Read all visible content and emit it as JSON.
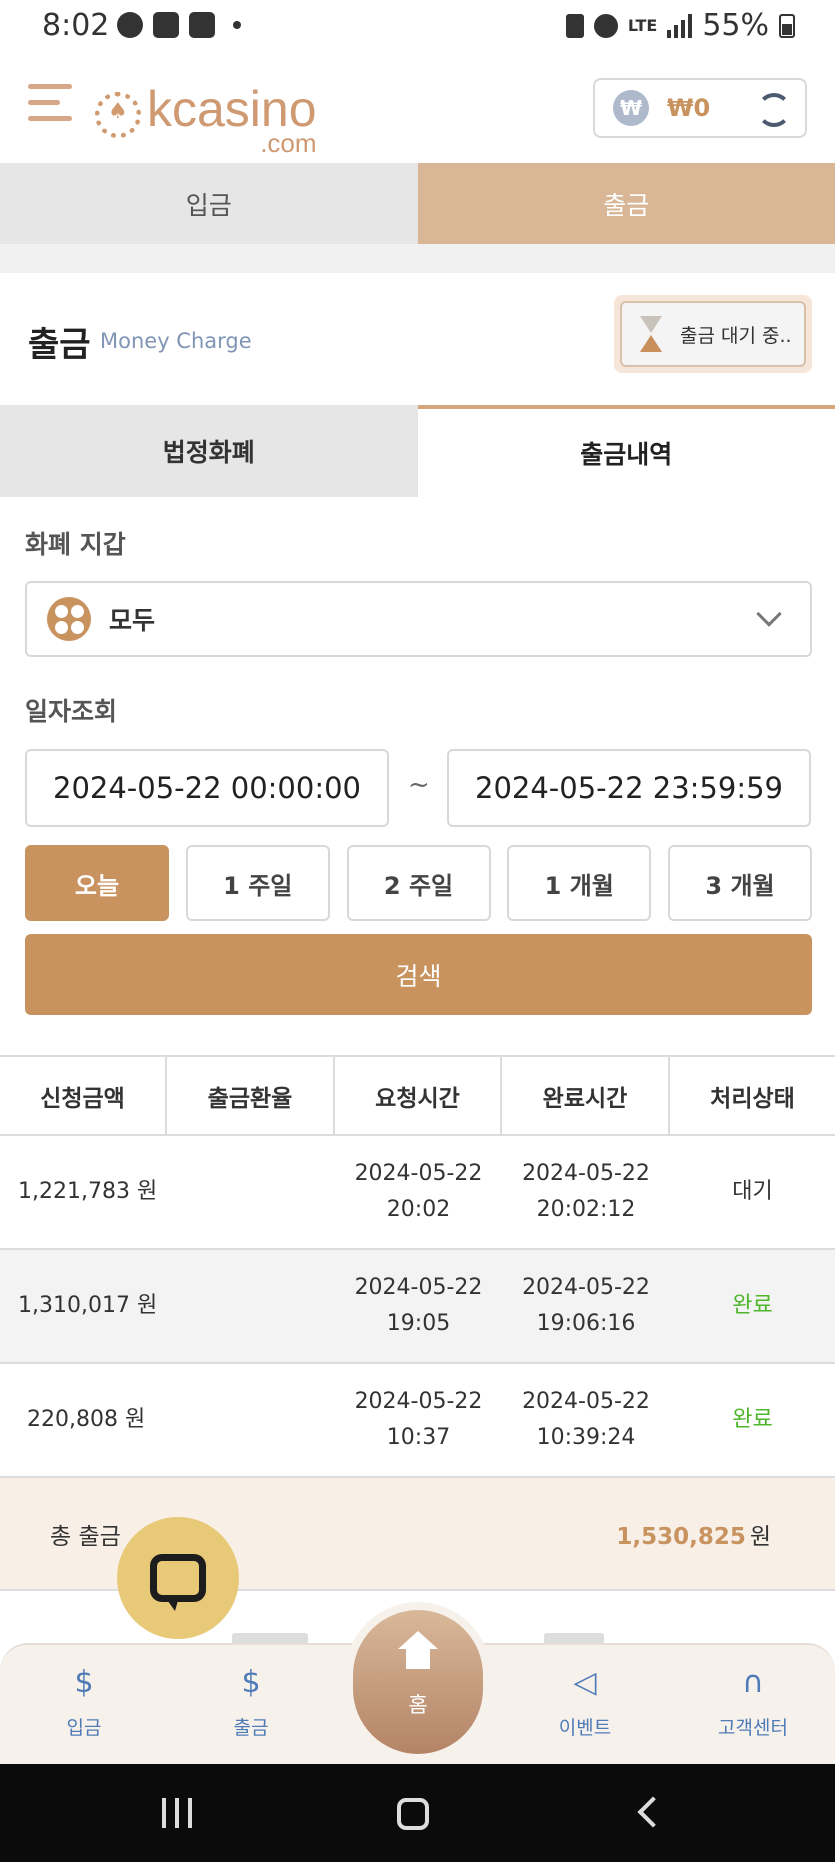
{
  "status_bar": {
    "time": "8:02",
    "battery": "55%",
    "network": "LTE"
  },
  "header": {
    "logo_text": "kcasino",
    "logo_domain": ".com",
    "currency_symbol": "₩",
    "balance": "₩0"
  },
  "main_tabs": [
    {
      "label": "입금",
      "active": false
    },
    {
      "label": "출금",
      "active": true
    }
  ],
  "title": {
    "main": "출금",
    "sub": "Money Charge",
    "pending_label": "출금 대기 중.."
  },
  "sub_tabs": [
    {
      "label": "법정화폐",
      "active": false
    },
    {
      "label": "출금내역",
      "active": true
    }
  ],
  "wallet_section": {
    "label": "화폐 지갑",
    "selected": "모두"
  },
  "date_section": {
    "label": "일자조회",
    "start": "2024-05-22 00:00:00",
    "end": "2024-05-22 23:59:59",
    "separator": "~"
  },
  "range_buttons": [
    {
      "label": "오늘",
      "active": true
    },
    {
      "label": "1 주일",
      "active": false
    },
    {
      "label": "2 주일",
      "active": false
    },
    {
      "label": "1 개월",
      "active": false
    },
    {
      "label": "3 개월",
      "active": false
    }
  ],
  "search_label": "검색",
  "table": {
    "headers": [
      "신청금액",
      "출금환율",
      "요청시간",
      "완료시간",
      "처리상태"
    ],
    "rows": [
      {
        "amount": "1,221,783 원",
        "rate": "",
        "req_date": "2024-05-22",
        "req_time": "20:02",
        "done_date": "2024-05-22",
        "done_time": "20:02:12",
        "status": "대기",
        "status_type": "wait"
      },
      {
        "amount": "1,310,017 원",
        "rate": "",
        "req_date": "2024-05-22",
        "req_time": "19:05",
        "done_date": "2024-05-22",
        "done_time": "19:06:16",
        "status": "완료",
        "status_type": "done"
      },
      {
        "amount": "220,808 원",
        "rate": "",
        "req_date": "2024-05-22",
        "req_time": "10:37",
        "done_date": "2024-05-22",
        "done_time": "10:39:24",
        "status": "완료",
        "status_type": "done"
      }
    ],
    "total_label": "총 출금",
    "total_amount": "1,530,825",
    "total_unit": "원"
  },
  "bottom_nav": {
    "items": [
      {
        "label": "입금",
        "icon": "deposit-icon"
      },
      {
        "label": "출금",
        "icon": "withdraw-icon"
      },
      {
        "label": "홈",
        "icon": "home-icon"
      },
      {
        "label": "이벤트",
        "icon": "megaphone-icon"
      },
      {
        "label": "고객센터",
        "icon": "headset-icon"
      }
    ]
  },
  "colors": {
    "accent": "#c8935f",
    "tab_active": "#d8b696",
    "status_done": "#4fb52b",
    "nav_blue": "#4f7bb7",
    "chat_fab": "#e8c978"
  }
}
